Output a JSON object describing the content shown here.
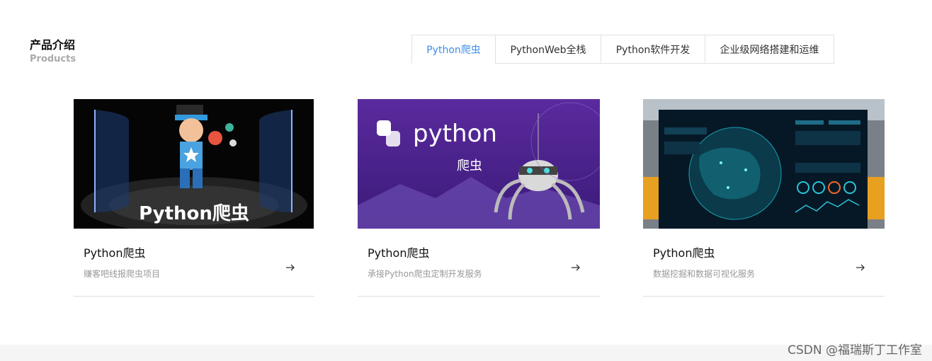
{
  "section": {
    "title": "产品介绍",
    "subtitle": "Products"
  },
  "tabs": [
    {
      "label": "Python爬虫",
      "active": true
    },
    {
      "label": "PythonWeb全栈",
      "active": false
    },
    {
      "label": "Python软件开发",
      "active": false
    },
    {
      "label": "企业级网络搭建和运维",
      "active": false
    }
  ],
  "cards": [
    {
      "image_caption": "Python爬虫",
      "title": "Python爬虫",
      "description": "赚客吧线报爬虫项目",
      "icon": "arrow-right-icon"
    },
    {
      "image_caption_logo": "python",
      "image_caption_sub": "爬虫",
      "title": "Python爬虫",
      "description": "承接Python爬虫定制开发服务",
      "icon": "arrow-right-icon"
    },
    {
      "title": "Python爬虫",
      "description": "数据挖掘和数据可视化服务",
      "icon": "arrow-right-icon"
    }
  ],
  "colors": {
    "accent": "#3b8ee8",
    "tab_border": "#e1e1e1",
    "footer_bg": "#f5f5f5"
  },
  "watermark": "CSDN @福瑞斯丁工作室"
}
